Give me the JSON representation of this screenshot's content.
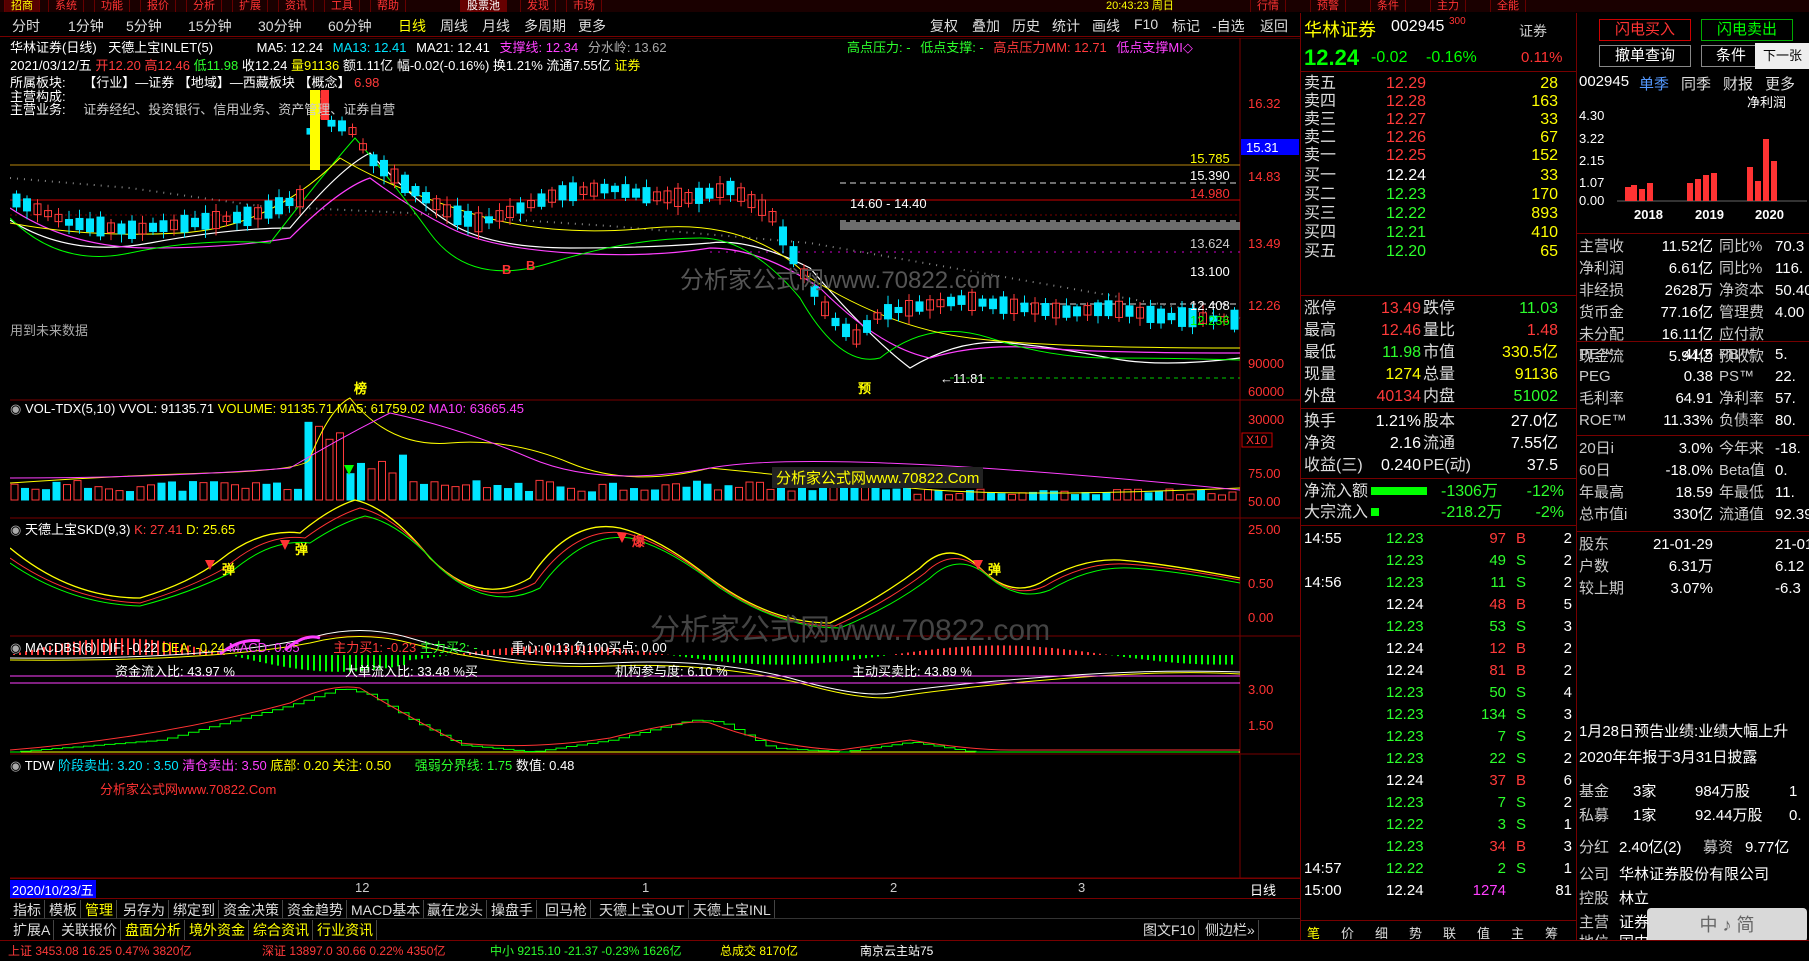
{
  "top_strip": {
    "tabs": [
      "系统",
      "功能",
      "报价",
      "分析",
      "扩展",
      "资讯",
      "工具",
      "帮助"
    ],
    "extra": [
      "股票池",
      "发现",
      "市场"
    ],
    "right_tabs": [
      "行情",
      "预警",
      "条件",
      "主力",
      "全能"
    ],
    "time": "20:43:23 周日",
    "logo": "招商"
  },
  "toolbar": {
    "periods": [
      "分时",
      "1分钟",
      "5分钟",
      "15分钟",
      "30分钟",
      "60分钟",
      "日线",
      "周线",
      "月线",
      "多周期",
      "更多"
    ],
    "active": "日线",
    "right": [
      "复权",
      "叠加",
      "历史",
      "统计",
      "画线",
      "F10",
      "标记",
      "-自选",
      "返回"
    ]
  },
  "main": {
    "header1": {
      "name": "华林证券(日线)",
      "indicator": "天德上宝INLET(5)",
      "ma5": "MA5: 12.24",
      "ma13": "MA13: 12.41",
      "ma21": "MA21: 12.41",
      "support": "支撑线: 12.34",
      "watershed": "分水岭: 13.62",
      "hp": "高点压力: -",
      "lp": "低点支撑: -",
      "hpmm": "高点压力MM: 12.71",
      "lpmm": "低点支撑MI◇"
    },
    "header2": {
      "date": "2021/03/12/五",
      "open": "开12.20",
      "high": "高12.46",
      "low": "低11.98",
      "close": "收12.24",
      "vol": "量91136",
      "amt": "额1.11亿",
      "chg": "幅-0.02(-0.16%)",
      "turn": "换1.21%",
      "float": "流通7.55亿",
      "sector": "证券"
    },
    "info": {
      "l1": "所属板块:",
      "l1v": "【行业】—证券  【地域】—西藏板块  【概念】",
      "l1n": "6.98",
      "l2": "主营构成:",
      "l3": "主营业务:",
      "l3v": "证券经纪、投资银行、信用业务、资产管理、证券自营"
    },
    "future_note": "用到未来数据",
    "level_labels": [
      "15.785",
      "15.390",
      "14.980",
      "14.60 - 14.40",
      "13.624",
      "13.100",
      "12.408",
      "12.236",
      "←11.81"
    ],
    "axis_main": [
      "16.32",
      "14.83",
      "13.49",
      "12.26"
    ],
    "crosshair": "15.31",
    "markers": [
      "榜",
      "预"
    ],
    "vol_header": {
      "name": "VOL-TDX(5,10)",
      "vvol": "VVOL: 91135.71",
      "volume": "VOLUME: 91135.71",
      "ma5": "MA5: 61759.02",
      "ma10": "MA10: 63665.45"
    },
    "axis_vol": [
      "90000",
      "60000",
      "30000"
    ],
    "vol_unit": "X10",
    "skd_header": {
      "name": "天德上宝SKD(9,3)",
      "k": "K: 27.41",
      "d": "D: 25.65"
    },
    "axis_skd": [
      "75.00",
      "50.00",
      "25.00"
    ],
    "skd_marks": [
      "弹",
      "弹",
      "爆",
      "弹"
    ],
    "macd_header": {
      "name": "MACDBS(6)",
      "dif": "DIF: -0.22",
      "dea": "DEA: -0.24",
      "macd": "MACD: 0.05",
      "zl1": "主力买1: -0.23",
      "zl2": "主力买2: -",
      "zx": "重心: 0.13",
      "b100": "负100买点: 0.00"
    },
    "macd_stats": [
      "资金流入比:  43.97 %",
      "大单流入比:  33.48 %买",
      "机构参与度:  6.10 %",
      "主动买卖比:  43.89 %"
    ],
    "axis_macd": [
      "0.50",
      "0.00"
    ],
    "tdw_header": {
      "name": "TDW",
      "jd": "阶段卖出: 3.20 : 3.50",
      "qc": "清仓卖出: 3.50",
      "db": "底部: 0.20",
      "gz": "关注: 0.50",
      "qr": "强弱分界线: 1.75",
      "sz": "数值: 0.48"
    },
    "axis_tdw": [
      "3.00",
      "1.50"
    ],
    "date_axis": {
      "start": "2020/10/23/五",
      "ticks": [
        "12",
        "1",
        "2",
        "3"
      ],
      "right": "日线"
    },
    "watermarks": [
      "分析家公式网www.70822.com",
      "分析家公式网www.70822.Com",
      "分析家公式网www.70822.com",
      "分析家公式网www.70822.Com"
    ]
  },
  "bottom_tabs": {
    "row1": [
      "指标",
      "模板",
      "管理",
      "另存为",
      "绑定到",
      "资金决策",
      "资金趋势",
      "MACD基本",
      "赢在龙头",
      "操盘手",
      "回马枪",
      "天德上宝OUT",
      "天德上宝INL"
    ],
    "selected": "管理",
    "row2": [
      "扩展A",
      "关联报价",
      "盘面分析",
      "境外资金",
      "综合资讯",
      "行业资讯"
    ],
    "right2": [
      "图文F10",
      "侧边栏»"
    ]
  },
  "quote": {
    "name": "华林证券",
    "code": "002945",
    "code_sup": "300",
    "industry": "证券",
    "price": "12.24",
    "chg": "-0.02",
    "pct": "-0.16%",
    "ind_pct": "0.11%",
    "asks": [
      [
        "卖五",
        "12.29",
        "28"
      ],
      [
        "卖四",
        "12.28",
        "163"
      ],
      [
        "卖三",
        "12.27",
        "33"
      ],
      [
        "卖二",
        "12.26",
        "67"
      ],
      [
        "卖一",
        "12.25",
        "152"
      ]
    ],
    "bids": [
      [
        "买一",
        "12.24",
        "33"
      ],
      [
        "买二",
        "12.23",
        "170"
      ],
      [
        "买三",
        "12.22",
        "893"
      ],
      [
        "买四",
        "12.21",
        "410"
      ],
      [
        "买五",
        "12.20",
        "65"
      ]
    ],
    "stats": [
      [
        "涨停",
        "13.49",
        "跌停",
        "11.03"
      ],
      [
        "最高",
        "12.46",
        "量比",
        "1.48"
      ],
      [
        "最低",
        "11.98",
        "市值",
        "330.5亿"
      ],
      [
        "现量",
        "1274",
        "总量",
        "91136"
      ],
      [
        "外盘",
        "40134",
        "内盘",
        "51002"
      ]
    ],
    "stats2": [
      [
        "换手",
        "1.21%",
        "股本",
        "27.0亿"
      ],
      [
        "净资",
        "2.16",
        "流通",
        "7.55亿"
      ],
      [
        "收益(三)",
        "0.240",
        "PE(动)",
        "37.5"
      ]
    ],
    "flow": [
      [
        "净流入额",
        "-1306万",
        "-12%"
      ],
      [
        "大宗流入",
        "-218.2万",
        "-2%"
      ]
    ],
    "ticks": [
      [
        "14:55",
        "12.23",
        "97",
        "B",
        "2"
      ],
      [
        "",
        "12.23",
        "49",
        "S",
        "2"
      ],
      [
        "14:56",
        "12.23",
        "11",
        "S",
        "2"
      ],
      [
        "",
        "12.24",
        "48",
        "B",
        "5"
      ],
      [
        "",
        "12.23",
        "53",
        "S",
        "3"
      ],
      [
        "",
        "12.24",
        "12",
        "B",
        "2"
      ],
      [
        "",
        "12.24",
        "81",
        "B",
        "2"
      ],
      [
        "",
        "12.23",
        "50",
        "S",
        "4"
      ],
      [
        "",
        "12.23",
        "134",
        "S",
        "3"
      ],
      [
        "",
        "12.23",
        "7",
        "S",
        "2"
      ],
      [
        "",
        "12.23",
        "22",
        "S",
        "2"
      ],
      [
        "",
        "12.24",
        "37",
        "B",
        "6"
      ],
      [
        "",
        "12.23",
        "7",
        "S",
        "2"
      ],
      [
        "",
        "12.22",
        "3",
        "S",
        "1"
      ],
      [
        "",
        "12.23",
        "34",
        "B",
        "3"
      ],
      [
        "14:57",
        "12.22",
        "2",
        "S",
        "1"
      ],
      [
        "15:00",
        "12.24",
        "1274",
        "",
        "81"
      ]
    ],
    "bottom_tabs": [
      "笔",
      "价",
      "细",
      "势",
      "联",
      "值",
      "主",
      "筹"
    ]
  },
  "fundamental": {
    "btn_buy": "闪电买入",
    "btn_sell": "闪电卖出",
    "btn_cancel": "撤单查询",
    "btn_cond": "条件",
    "next": "下一张",
    "code": "002945",
    "tabs": [
      "单季",
      "同季",
      "财报",
      "更多"
    ],
    "chart_title": "净利润",
    "chart_axis": [
      "4.30",
      "3.22",
      "2.15",
      "1.07",
      "0.00"
    ],
    "years": [
      "2018",
      "2019",
      "2020"
    ],
    "rows": [
      [
        "主营收",
        "11.52亿",
        "同比%",
        "70.3"
      ],
      [
        "净利润",
        "6.61亿",
        "同比%",
        "116."
      ],
      [
        "非经损",
        "2628万",
        "净资本",
        "50.40"
      ],
      [
        "货币金",
        "77.16亿",
        "管理费",
        "4.00"
      ],
      [
        "未分配",
        "16.11亿",
        "应付款",
        ""
      ],
      [
        "现金流",
        "5.94亿",
        "预收款",
        ""
      ]
    ],
    "rows2": [
      [
        "PE™",
        "41.5",
        "PB™",
        "5."
      ],
      [
        "PEG",
        "0.38",
        "PS™",
        "22."
      ],
      [
        "毛利率",
        "64.91",
        "净利率",
        "57."
      ],
      [
        "ROE™",
        "11.33%",
        "负债率",
        "80."
      ]
    ],
    "rows3": [
      [
        "20日i",
        "3.0%",
        "今年来",
        "-18."
      ],
      [
        "60日",
        "-18.0%",
        "Beta值",
        "0."
      ],
      [
        "年最高",
        "18.59",
        "年最低",
        "11."
      ],
      [
        "总市值i",
        "330亿",
        "流通值",
        "92.39"
      ]
    ],
    "rows4": [
      [
        "股东",
        "21-01-29",
        "",
        "21-01-"
      ],
      [
        "户数",
        "6.31万",
        "",
        "6.12"
      ],
      [
        "较上期",
        "3.07%",
        "",
        "-6.3"
      ]
    ],
    "news1": "1月28日预告业绩:业绩大幅上升",
    "news2": "2020年年报于3月31日披露",
    "rows5": [
      [
        "基金",
        "3家",
        "984万股",
        "1"
      ],
      [
        "私募",
        "1家",
        "92.44万股",
        "0."
      ]
    ],
    "rows6": [
      [
        "分红",
        "2.40亿(2)",
        "募资",
        "9.77亿"
      ]
    ],
    "company": [
      "公司",
      "华林证券股份有限公司"
    ],
    "holder": [
      "控股",
      "林立"
    ],
    "biz": [
      "主营",
      "证券"
    ],
    "loc": [
      "地位",
      "国内"
    ],
    "watermark": "中 ♪ 简"
  },
  "statusbar": {
    "items": [
      "上证 3453.08  16.25  0.47%  3820亿",
      "深证 13897.0  30.66  0.22%  4350亿",
      "中小 9215.10  -21.37  -0.23%  1626亿",
      "总成交 8170亿",
      "南京云主站75"
    ]
  },
  "colors": {
    "up": "#ff3a3a",
    "down": "#00e5ff",
    "grid": "#700"
  }
}
